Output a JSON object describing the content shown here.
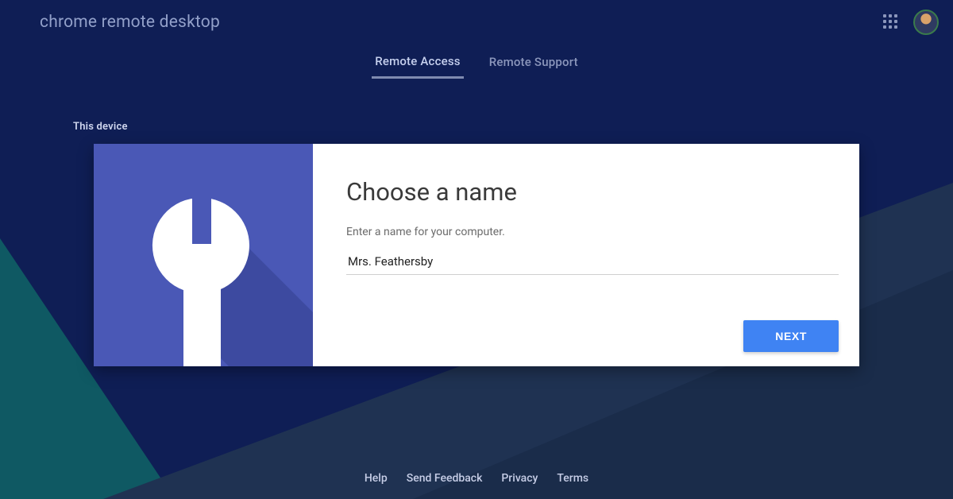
{
  "app_title": "chrome remote desktop",
  "tabs": {
    "remote_access": "Remote Access",
    "remote_support": "Remote Support"
  },
  "section_label": "This device",
  "card": {
    "title": "Choose a name",
    "description": "Enter a name for your computer.",
    "input_value": "Mrs. Feathersby",
    "next_label": "NEXT"
  },
  "footer": {
    "help": "Help",
    "feedback": "Send Feedback",
    "privacy": "Privacy",
    "terms": "Terms"
  },
  "colors": {
    "bg_base": "#0f1e55",
    "bg_teal": "#0f5963",
    "bg_slate": "#1c314f",
    "card_accent": "#4a58b6",
    "primary_button": "#3f83f3"
  }
}
